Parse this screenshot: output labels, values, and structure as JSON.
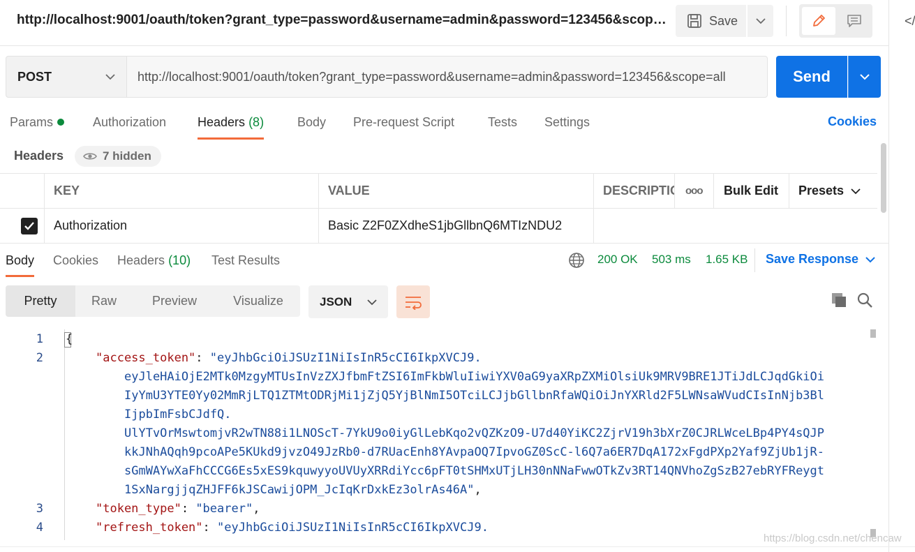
{
  "title": "http://localhost:9001/oauth/token?grant_type=password&username=admin&password=123456&scope=...",
  "toolbar": {
    "save_label": "Save",
    "right_glyph": "</"
  },
  "request": {
    "method": "POST",
    "url": "http://localhost:9001/oauth/token?grant_type=password&username=admin&password=123456&scope=all",
    "send_label": "Send"
  },
  "req_tabs": {
    "params": "Params",
    "authorization": "Authorization",
    "headers": "Headers",
    "headers_count": "(8)",
    "body": "Body",
    "prerequest": "Pre-request Script",
    "tests": "Tests",
    "settings": "Settings",
    "cookies": "Cookies"
  },
  "headers_section": {
    "label": "Headers",
    "hidden": "7 hidden",
    "columns": {
      "key": "KEY",
      "value": "VALUE",
      "description": "DESCRIPTIO",
      "more": "ooo",
      "bulk_edit": "Bulk Edit",
      "presets": "Presets"
    },
    "rows": [
      {
        "key": "Authorization",
        "value": "Basic Z2F0ZXdheS1jbGllbnQ6MTIzNDU2"
      }
    ]
  },
  "response": {
    "tabs": {
      "body": "Body",
      "cookies": "Cookies",
      "headers": "Headers",
      "headers_count": "(10)",
      "test_results": "Test Results"
    },
    "status": "200 OK",
    "time": "503 ms",
    "size": "1.65 KB",
    "save_label": "Save Response",
    "views": {
      "pretty": "Pretty",
      "raw": "Raw",
      "preview": "Preview",
      "visualize": "Visualize"
    },
    "format": "JSON"
  },
  "code": {
    "l1": "{",
    "l2_key": "\"access_token\"",
    "l2_val": "\"eyJhbGciOiJSUzI1NiIsInR5cCI6IkpXVCJ9.",
    "w1": "eyJleHAiOjE2MTk0MzgyMTUsInVzZXJfbmFtZSI6ImFkbWluIiwiYXV0aG9yaXRpZXMiOlsiUk9MRV9BRE1JTiJdLCJqdGkiOi",
    "w2": "IyYmU3YTE0Yy02MmRjLTQ1ZTMtODRjMi1jZjQ5YjBlNmI5OTciLCJjbGllbnRfaWQiOiJnYXRld2F5LWNsaWVudCIsInNjb3Bl",
    "w3": "IjpbImFsbCJdfQ.",
    "w4": "UlYTvOrMswtomjvR2wTN88i1LNOScT-7YkU9o0iyGlLebKqo2vQZKzO9-U7d40YiKC2ZjrV19h3bXrZ0CJRLWceLBp4PY4sQJP",
    "w5": "kkJNhAQqh9pcoAPe5KUkd9jvzO49JzRb0-d7RUacEnh8YAvpaOQ7IpvoGZ0ScC-l6Q7a6ER7DqA172xFgdPXp2Yaf9ZjUb1jR-",
    "w6": "sGmWAYwXaFhCCCG6Es5xES9kquwyyoUVUyXRRdiYcc6pFT0tSHMxUTjLH30nNNaFwwOTkZv3RT14QNVhoZgSzB27ebRYFReygt",
    "w7": "1SxNargjjqZHJFF6kJSCawijOPM_JcIqKrDxkEz3olrAs46A\"",
    "l3_key": "\"token_type\"",
    "l3_val": "\"bearer\"",
    "l4_key": "\"refresh_token\"",
    "l4_val": "\"eyJhbGciOiJSUzI1NiIsInR5cCI6IkpXVCJ9.",
    "line_numbers": [
      "1",
      "2",
      "3",
      "4"
    ]
  },
  "watermark": "https://blog.csdn.net/chencaw",
  "colors": {
    "accent": "#0f72e5",
    "tab_indicator": "#f26b3a",
    "success": "#0b8a3c"
  }
}
